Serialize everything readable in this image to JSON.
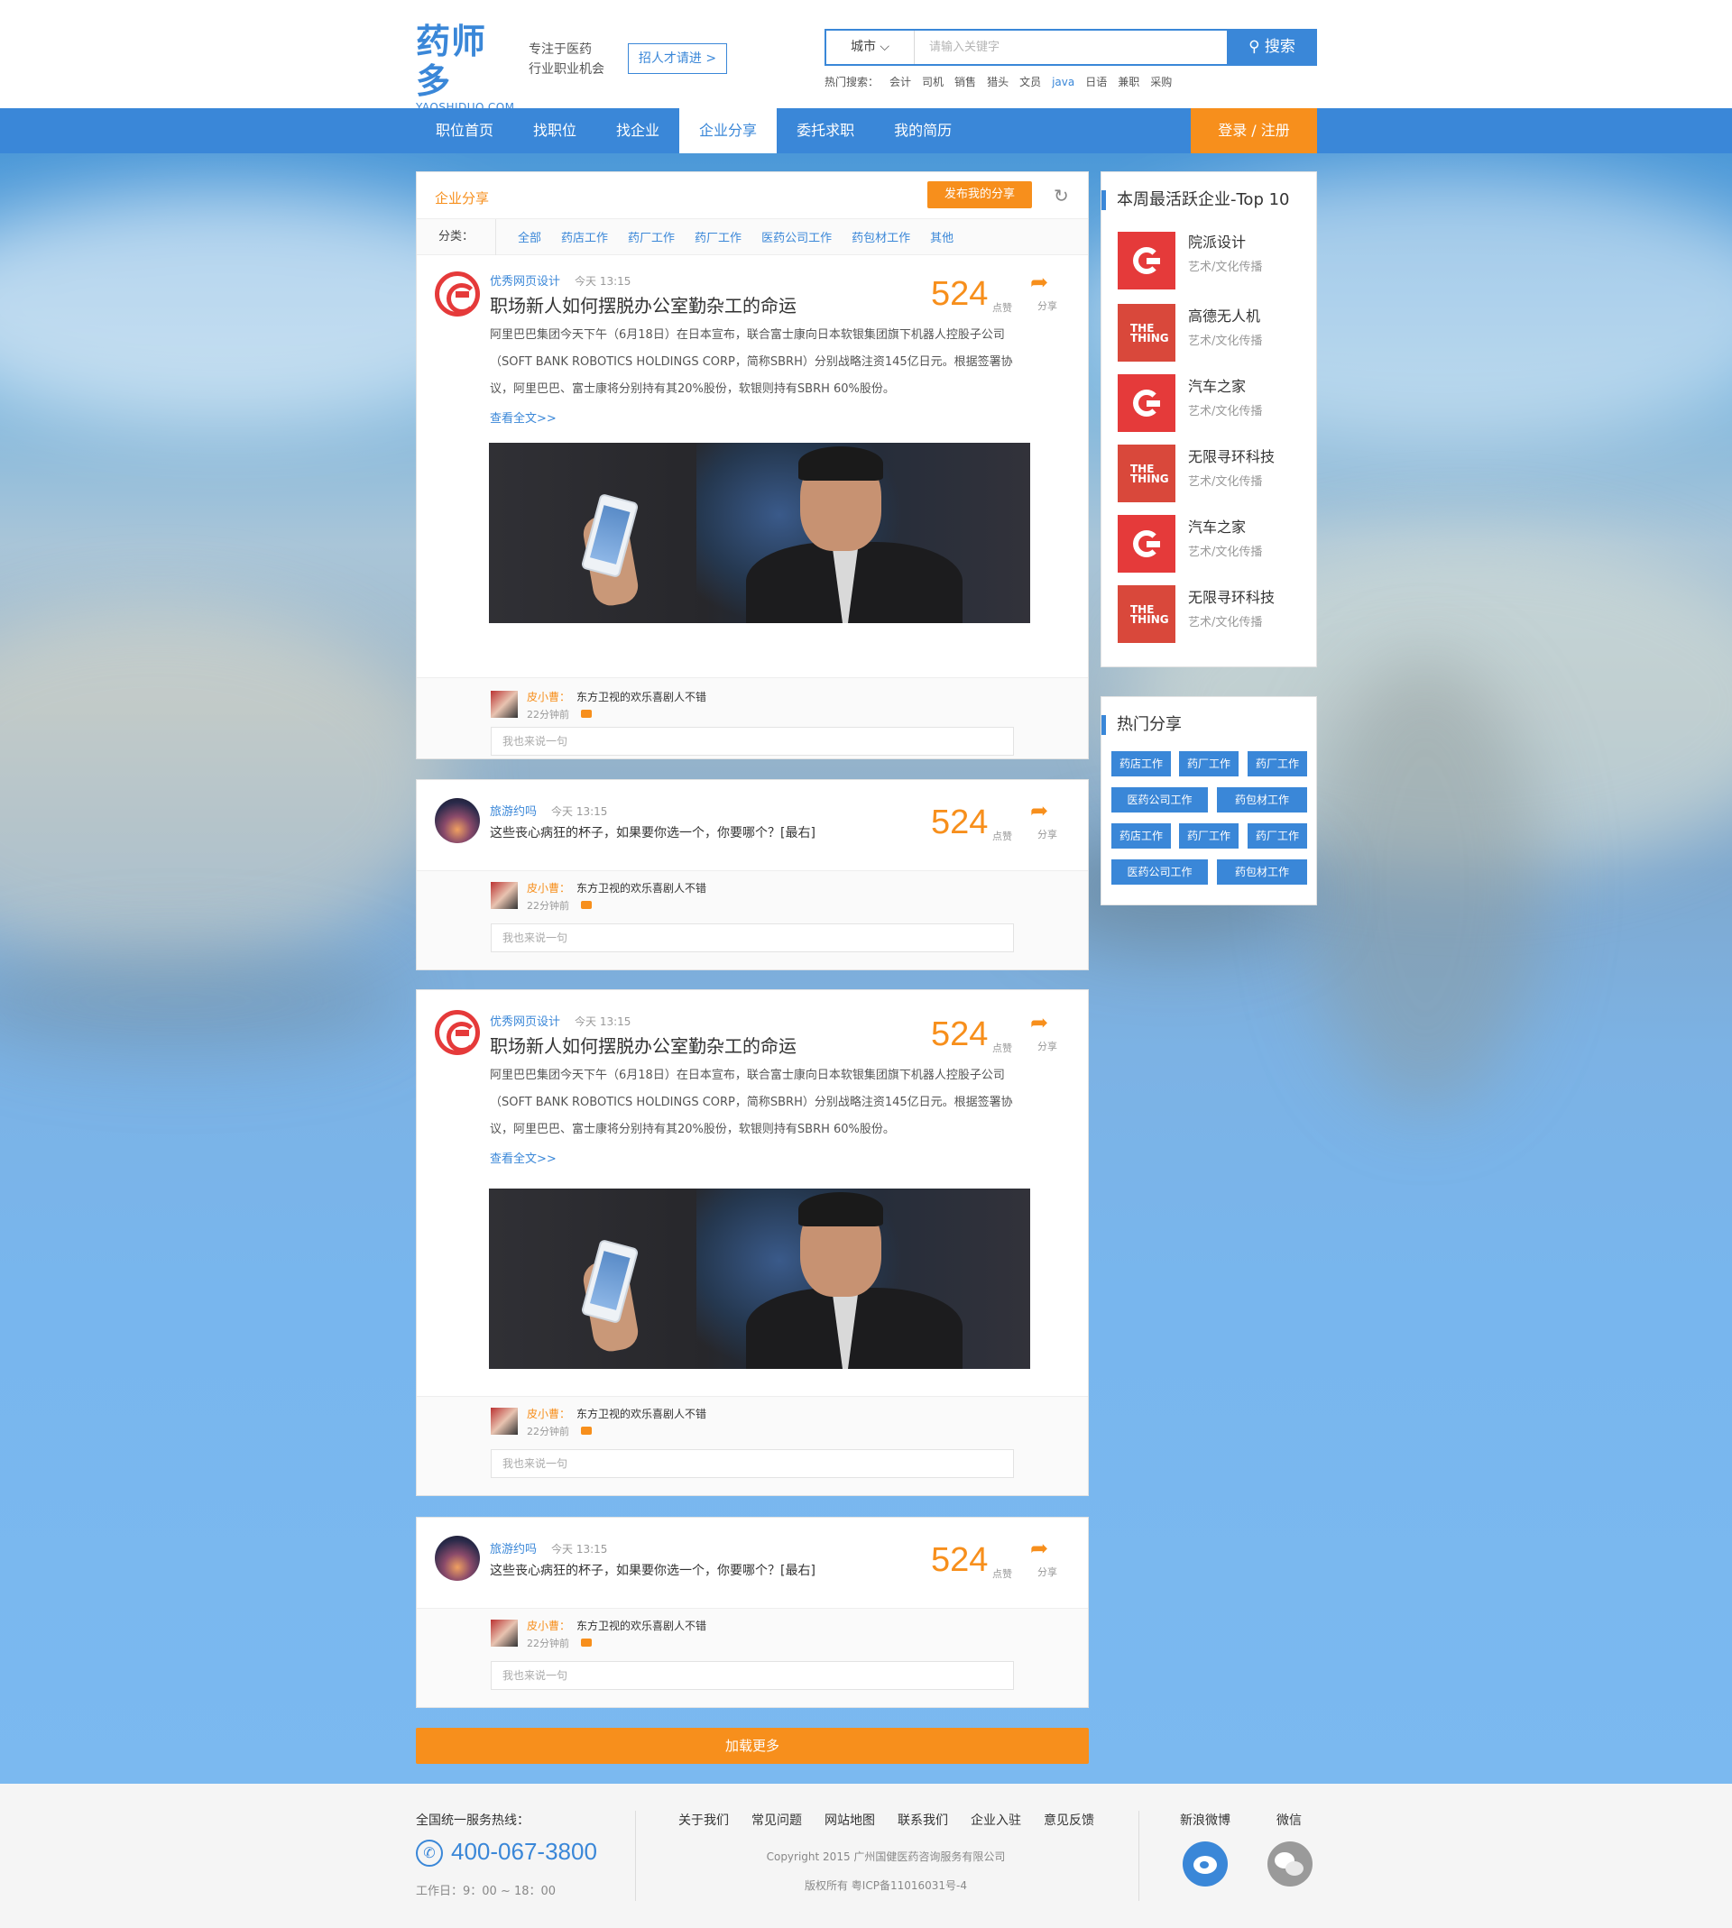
{
  "header": {
    "logo_cn": "药师多",
    "logo_en": "YAOSHIDUO.COM",
    "slogan_line1": "专注于医药",
    "slogan_line2": "行业职业机会",
    "recruit_label": "招人才请进 >",
    "city_label": "城市",
    "search_placeholder": "请输入关键字",
    "search_button": "搜索",
    "hot_label": "热门搜索：",
    "hot_keywords": [
      "会计",
      "司机",
      "销售",
      "猎头",
      "文员",
      "java",
      "日语",
      "兼职",
      "采购"
    ]
  },
  "nav": {
    "items": [
      "职位首页",
      "找职位",
      "找企业",
      "企业分享",
      "委托求职",
      "我的简历"
    ],
    "active_index": 3,
    "login_label": "登录 / 注册"
  },
  "share_panel": {
    "title": "企业分享",
    "publish_button": "发布我的分享",
    "category_label": "分类：",
    "categories": [
      "全部",
      "药店工作",
      "药厂工作",
      "药厂工作",
      "医药公司工作",
      "药包材工作",
      "其他"
    ]
  },
  "posts": [
    {
      "author": "优秀网页设计",
      "time": "今天 13:15",
      "title": "职场新人如何摆脱办公室勤杂工的命运",
      "body": "阿里巴巴集团今天下午（6月18日）在日本宣布，联合富士康向日本软银集团旗下机器人控股子公司（SOFT BANK ROBOTICS HOLDINGS CORP，简称SBRH）分别战略注资145亿日元。根据签署协议，阿里巴巴、富士康将分别持有其20%股份，软银则持有SBRH 60%股份。",
      "more": "查看全文>>",
      "likes": "524",
      "likes_label": "点赞",
      "share_label": "分享",
      "comment": {
        "name": "皮小曹：",
        "text": "东方卫视的欢乐喜剧人不错",
        "time": "22分钟前",
        "input_placeholder": "我也来说一句"
      }
    },
    {
      "author": "旅游约吗",
      "time": "今天 13:15",
      "title": "这些丧心病狂的杯子，如果要你选一个，你要哪个？[最右]",
      "likes": "524",
      "likes_label": "点赞",
      "share_label": "分享",
      "comment": {
        "name": "皮小曹：",
        "text": "东方卫视的欢乐喜剧人不错",
        "time": "22分钟前",
        "input_placeholder": "我也来说一句"
      }
    },
    {
      "author": "优秀网页设计",
      "time": "今天 13:15",
      "title": "职场新人如何摆脱办公室勤杂工的命运",
      "body": "阿里巴巴集团今天下午（6月18日）在日本宣布，联合富士康向日本软银集团旗下机器人控股子公司（SOFT BANK ROBOTICS HOLDINGS CORP，简称SBRH）分别战略注资145亿日元。根据签署协议，阿里巴巴、富士康将分别持有其20%股份，软银则持有SBRH 60%股份。",
      "more": "查看全文>>",
      "likes": "524",
      "likes_label": "点赞",
      "share_label": "分享",
      "comment": {
        "name": "皮小曹：",
        "text": "东方卫视的欢乐喜剧人不错",
        "time": "22分钟前",
        "input_placeholder": "我也来说一句"
      }
    },
    {
      "author": "旅游约吗",
      "time": "今天 13:15",
      "title": "这些丧心病狂的杯子，如果要你选一个，你要哪个？[最右]",
      "likes": "524",
      "likes_label": "点赞",
      "share_label": "分享",
      "comment": {
        "name": "皮小曹：",
        "text": "东方卫视的欢乐喜剧人不错",
        "time": "22分钟前",
        "input_placeholder": "我也来说一句"
      }
    }
  ],
  "load_more": "加载更多",
  "top_companies": {
    "title": "本周最活跃企业-Top 10",
    "items": [
      {
        "name": "院派设计",
        "category": "艺术/文化传播",
        "logo": "g-logo"
      },
      {
        "name": "高德无人机",
        "category": "艺术/文化传播",
        "logo": "the-thing-logo"
      },
      {
        "name": "汽车之家",
        "category": "艺术/文化传播",
        "logo": "g-logo"
      },
      {
        "name": "无限寻环科技",
        "category": "艺术/文化传播",
        "logo": "the-thing-logo"
      },
      {
        "name": "汽车之家",
        "category": "艺术/文化传播",
        "logo": "g-logo"
      },
      {
        "name": "无限寻环科技",
        "category": "艺术/文化传播",
        "logo": "the-thing-logo"
      }
    ],
    "logo_text": "THE THING"
  },
  "hot_shares": {
    "title": "热门分享",
    "tags": [
      "药店工作",
      "药厂工作",
      "药厂工作",
      "医药公司工作",
      "药包材工作",
      "药店工作",
      "药厂工作",
      "药厂工作",
      "医药公司工作",
      "药包材工作"
    ]
  },
  "footer": {
    "hotline_label": "全国统一服务热线：",
    "hotline": "400-067-3800",
    "worktime": "工作日：9：00 ~ 18：00",
    "links": [
      "关于我们",
      "常见问题",
      "网站地图",
      "联系我们",
      "企业入驻",
      "意见反馈"
    ],
    "copyright": "Copyright 2015 广州国健医药咨询服务有限公司",
    "icp": "版权所有    粤ICP备11016031号-4",
    "weibo_label": "新浪微博",
    "wechat_label": "微信"
  },
  "colors": {
    "primary": "#3a87d8",
    "accent": "#f78f1c"
  }
}
